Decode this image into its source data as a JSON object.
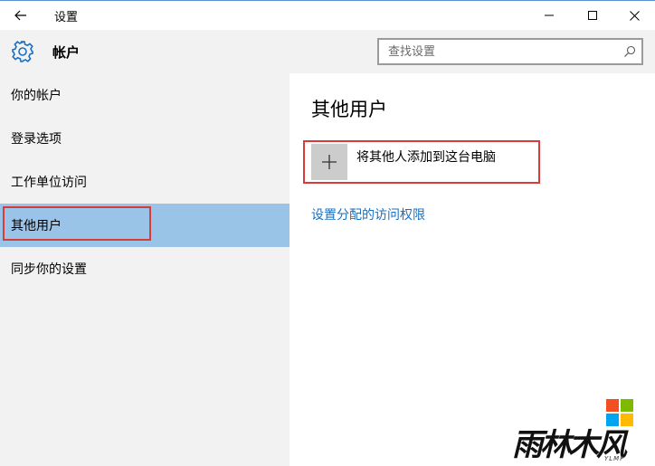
{
  "window": {
    "title": "设置",
    "accent": "#5a8fd0"
  },
  "header": {
    "title": "帐户",
    "search_placeholder": "查找设置"
  },
  "sidebar": {
    "items": [
      {
        "label": "你的帐户"
      },
      {
        "label": "登录选项"
      },
      {
        "label": "工作单位访问"
      },
      {
        "label": "其他用户",
        "selected": true
      },
      {
        "label": "同步你的设置"
      }
    ],
    "selected_color": "#9ac3e8"
  },
  "main": {
    "section_title": "其他用户",
    "add_user_label": "将其他人添加到这台电脑",
    "assigned_access_link": "设置分配的访问权限",
    "link_color": "#1a6fbf"
  },
  "annotations": {
    "highlight_color": "#d93b3b"
  },
  "watermark": {
    "brand_text": "雨林木风",
    "sub_text": "YLMF"
  }
}
